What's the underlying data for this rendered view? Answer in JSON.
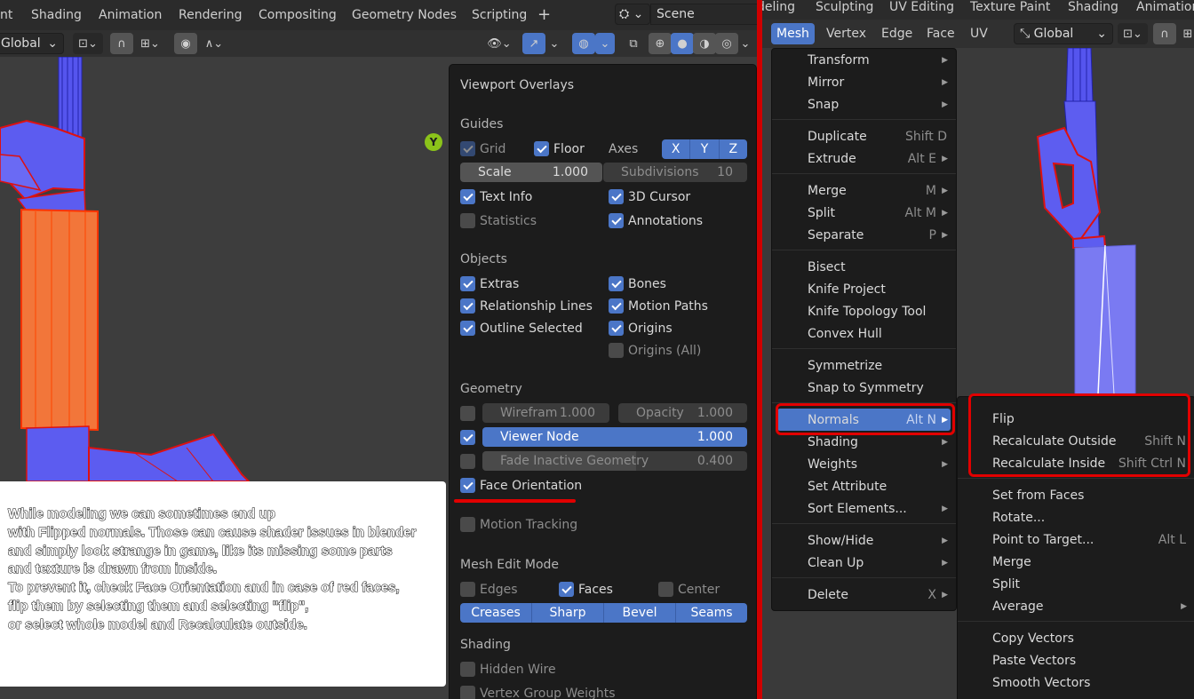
{
  "left_topbar": {
    "tabs": [
      "nt",
      "Shading",
      "Animation",
      "Rendering",
      "Compositing",
      "Geometry Nodes",
      "Scripting"
    ],
    "add_tab": "+",
    "scene_label": "Scene"
  },
  "left_header": {
    "orientation": "Global"
  },
  "gizmo": {
    "y_label": "Y"
  },
  "overlays": {
    "title": "Viewport Overlays",
    "guides": {
      "label": "Guides",
      "grid": "Grid",
      "floor": "Floor",
      "axes": "Axes",
      "x": "X",
      "y": "Y",
      "z": "Z",
      "scale_label": "Scale",
      "scale_value": "1.000",
      "subdivisions_label": "Subdivisions",
      "subdivisions_value": "10",
      "text_info": "Text Info",
      "cursor_3d": "3D Cursor",
      "statistics": "Statistics",
      "annotations": "Annotations"
    },
    "objects": {
      "label": "Objects",
      "extras": "Extras",
      "bones": "Bones",
      "relationship_lines": "Relationship Lines",
      "motion_paths": "Motion Paths",
      "outline_selected": "Outline Selected",
      "origins": "Origins",
      "origins_all": "Origins (All)"
    },
    "geometry": {
      "label": "Geometry",
      "wireframe_label": "Wirefram",
      "wireframe_value": "1.000",
      "opacity_label": "Opacity",
      "opacity_value": "1.000",
      "viewer_node_label": "Viewer Node",
      "viewer_node_value": "1.000",
      "fade_label": "Fade Inactive Geometry",
      "fade_value": "0.400",
      "face_orientation": "Face Orientation"
    },
    "motion_tracking": "Motion Tracking",
    "mesh_edit": {
      "label": "Mesh Edit Mode",
      "edges": "Edges",
      "faces": "Faces",
      "center": "Center",
      "creases": "Creases",
      "sharp": "Sharp",
      "bevel": "Bevel",
      "seams": "Seams"
    },
    "shading": {
      "label": "Shading",
      "hidden_wire": "Hidden Wire",
      "vertex_group_weights": "Vertex Group Weights"
    }
  },
  "note": "While modeling we can sometimes end up\nwith Flipped normals. Those can cause shader issues in blender\nand simply look strange in game, like its missing some parts\nand texture is drawn from inside.\nTo prevent it, check Face Orientation and in case of red faces,\nflip them by selecting  them and selecting \"flip\",\nor select whole model and Recalculate outside.",
  "right_topbar": {
    "tabs": [
      "deling",
      "Sculpting",
      "UV Editing",
      "Texture Paint",
      "Shading",
      "Animation"
    ]
  },
  "right_header": {
    "menus": [
      "Mesh",
      "Vertex",
      "Edge",
      "Face",
      "UV"
    ],
    "orientation": "Global"
  },
  "mesh_menu": [
    {
      "label": "Transform",
      "shortcut": "",
      "sub": true
    },
    {
      "label": "Mirror",
      "shortcut": "",
      "sub": true
    },
    {
      "label": "Snap",
      "shortcut": "",
      "sub": true
    },
    {
      "label": "Duplicate",
      "shortcut": "Shift D",
      "sub": false
    },
    {
      "label": "Extrude",
      "shortcut": "Alt E",
      "sub": true
    },
    {
      "label": "Merge",
      "shortcut": "M",
      "sub": true
    },
    {
      "label": "Split",
      "shortcut": "Alt M",
      "sub": true
    },
    {
      "label": "Separate",
      "shortcut": "P",
      "sub": true
    },
    {
      "label": "Bisect",
      "shortcut": "",
      "sub": false
    },
    {
      "label": "Knife Project",
      "shortcut": "",
      "sub": false
    },
    {
      "label": "Knife Topology Tool",
      "shortcut": "",
      "sub": false
    },
    {
      "label": "Convex Hull",
      "shortcut": "",
      "sub": false
    },
    {
      "label": "Symmetrize",
      "shortcut": "",
      "sub": false
    },
    {
      "label": "Snap to Symmetry",
      "shortcut": "",
      "sub": false
    },
    {
      "label": "Normals",
      "shortcut": "Alt N",
      "sub": true
    },
    {
      "label": "Shading",
      "shortcut": "",
      "sub": true
    },
    {
      "label": "Weights",
      "shortcut": "",
      "sub": true
    },
    {
      "label": "Set Attribute",
      "shortcut": "",
      "sub": false
    },
    {
      "label": "Sort Elements...",
      "shortcut": "",
      "sub": true
    },
    {
      "label": "Show/Hide",
      "shortcut": "",
      "sub": true
    },
    {
      "label": "Clean Up",
      "shortcut": "",
      "sub": true
    },
    {
      "label": "Delete",
      "shortcut": "X",
      "sub": true
    }
  ],
  "normals_menu": [
    {
      "label": "Flip",
      "shortcut": "",
      "sub": false
    },
    {
      "label": "Recalculate Outside",
      "shortcut": "Shift N",
      "sub": false
    },
    {
      "label": "Recalculate Inside",
      "shortcut": "Shift Ctrl N",
      "sub": false
    },
    {
      "label": "Set from Faces",
      "shortcut": "",
      "sub": false
    },
    {
      "label": "Rotate...",
      "shortcut": "",
      "sub": false
    },
    {
      "label": "Point to Target...",
      "shortcut": "Alt L",
      "sub": false
    },
    {
      "label": "Merge",
      "shortcut": "",
      "sub": false
    },
    {
      "label": "Split",
      "shortcut": "",
      "sub": false
    },
    {
      "label": "Average",
      "shortcut": "",
      "sub": true
    },
    {
      "label": "Copy Vectors",
      "shortcut": "",
      "sub": false
    },
    {
      "label": "Paste Vectors",
      "shortcut": "",
      "sub": false
    },
    {
      "label": "Smooth Vectors",
      "shortcut": "",
      "sub": false
    }
  ],
  "colors": {
    "accent": "#4b76c7",
    "annotation_red": "#e10000",
    "panel_bg": "#1c1c1c",
    "mesh_blue": "#5d5df0",
    "mesh_orange": "#f07a3c"
  }
}
